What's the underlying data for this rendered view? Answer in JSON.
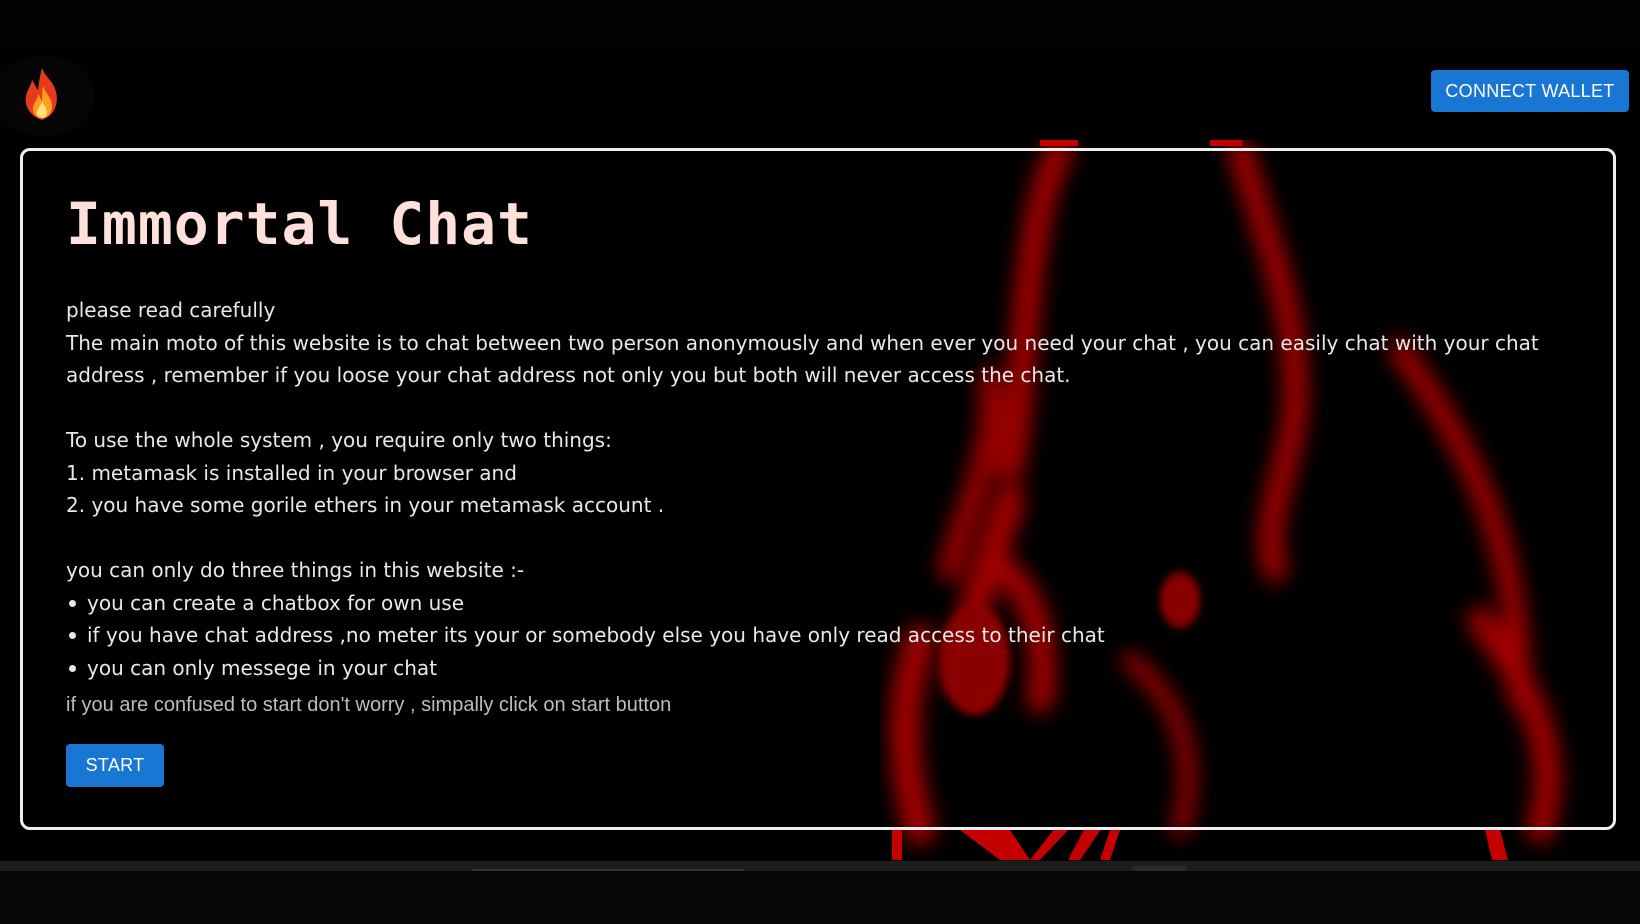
{
  "header": {
    "logo_icon": "fire-icon",
    "connect_label": "CONNECT WALLET"
  },
  "main": {
    "title": "Immortal Chat",
    "intro": [
      "please read carefully",
      "The main moto of this website is to chat between two person anonymously and when ever you need your chat , you can easily chat with your chat address , remember if you loose your chat address not only you but both will never access the chat."
    ],
    "requirements": [
      "To use the whole system , you require only two things:",
      "1. metamask is installed in your browser and",
      "2. you have some gorile ethers in your metamask account ."
    ],
    "things_heading": "you can only do three things in this website :-",
    "things": [
      "you can create a chatbox for own use",
      "if you have chat address ,no meter its your or somebody else you have only read access to their chat",
      "you can only messege in your chat"
    ],
    "hint": "if you are confused to start don't worry , simpally click on start button",
    "start_label": "START"
  },
  "colors": {
    "accent": "#1976d2",
    "title": "#fde1da",
    "background": "#000000",
    "art": "#b00000"
  }
}
